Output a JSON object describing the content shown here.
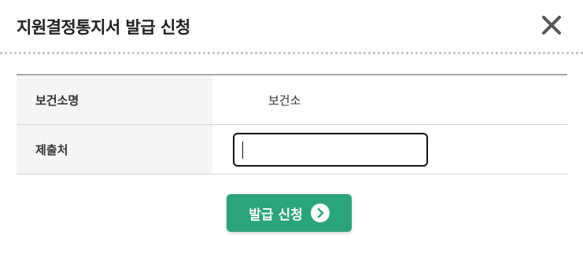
{
  "dialog": {
    "title": "지원결정통지서 발급 신청",
    "close_icon": "close-icon"
  },
  "form": {
    "rows": [
      {
        "label": "보건소명",
        "value": "보건소"
      },
      {
        "label": "제출처",
        "input_value": ""
      }
    ]
  },
  "submit": {
    "label": "발급 신청",
    "icon": "chevron-right-circle-icon"
  },
  "colors": {
    "accent": "#2aa57a",
    "label_background": "#f4f6f4"
  }
}
